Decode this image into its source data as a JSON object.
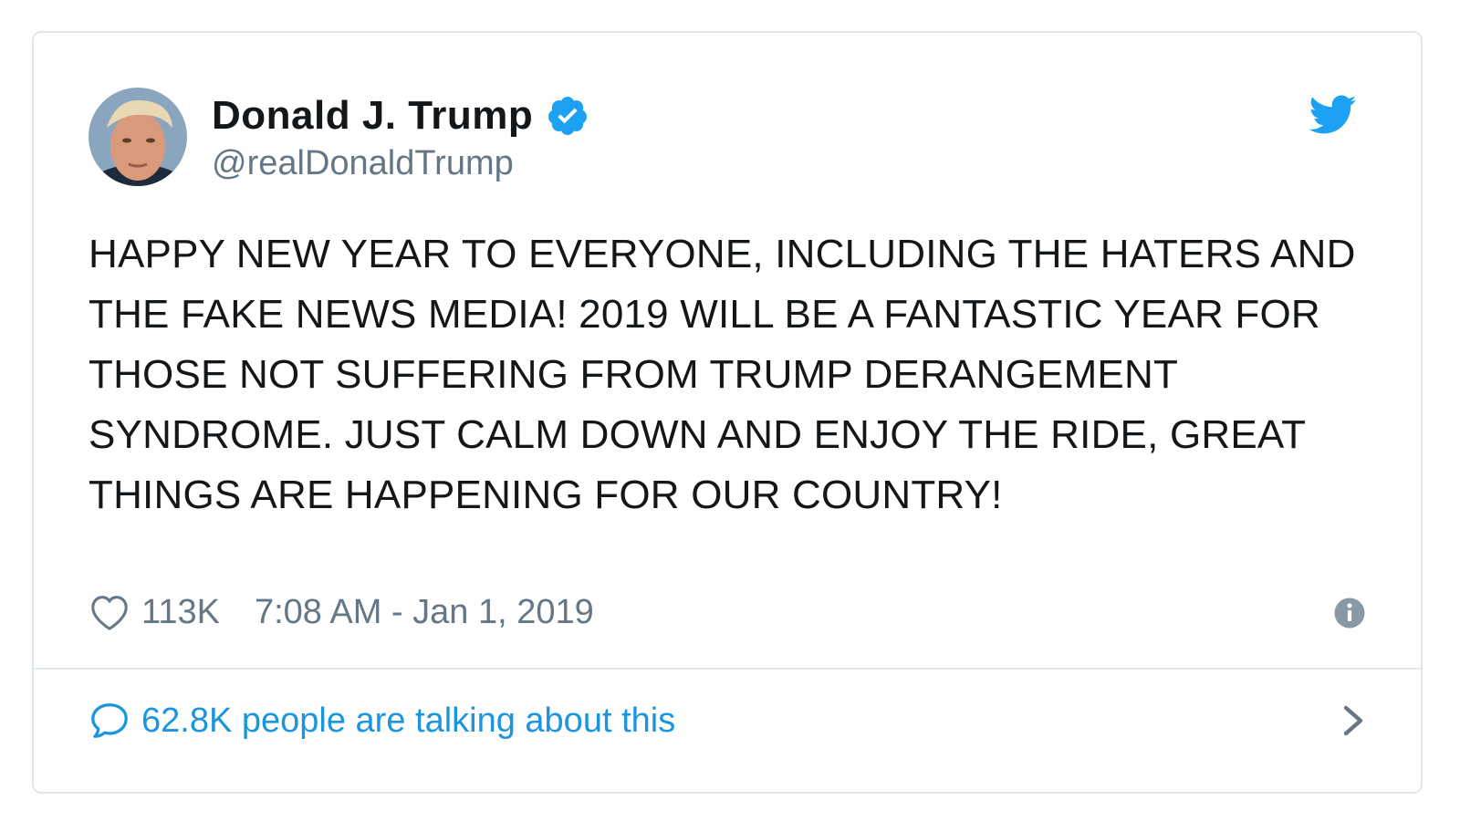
{
  "tweet": {
    "author": {
      "display_name": "Donald J. Trump",
      "handle": "@realDonaldTrump",
      "verified": true
    },
    "text": "HAPPY NEW YEAR TO EVERYONE, INCLUDING THE HATERS AND THE FAKE NEWS MEDIA! 2019 WILL BE A FANTASTIC YEAR FOR THOSE NOT SUFFERING FROM TRUMP DERANGEMENT SYNDROME. JUST CALM DOWN AND ENJOY THE RIDE, GREAT THINGS ARE HAPPENING FOR OUR COUNTRY!",
    "likes": "113K",
    "timestamp": "7:08 AM - Jan 1, 2019",
    "footer_label": "62.8K people are talking about this"
  },
  "icons": {
    "verified": "verified-badge-icon",
    "bird": "twitter-bird-icon",
    "heart": "heart-icon",
    "info": "info-icon",
    "comment": "speech-bubble-icon",
    "chevron": "chevron-right-icon"
  },
  "colors": {
    "text": "#14171a",
    "secondary": "#657786",
    "accent": "#1da1f2",
    "link": "#1b95e0",
    "border": "#e1e8ed"
  }
}
